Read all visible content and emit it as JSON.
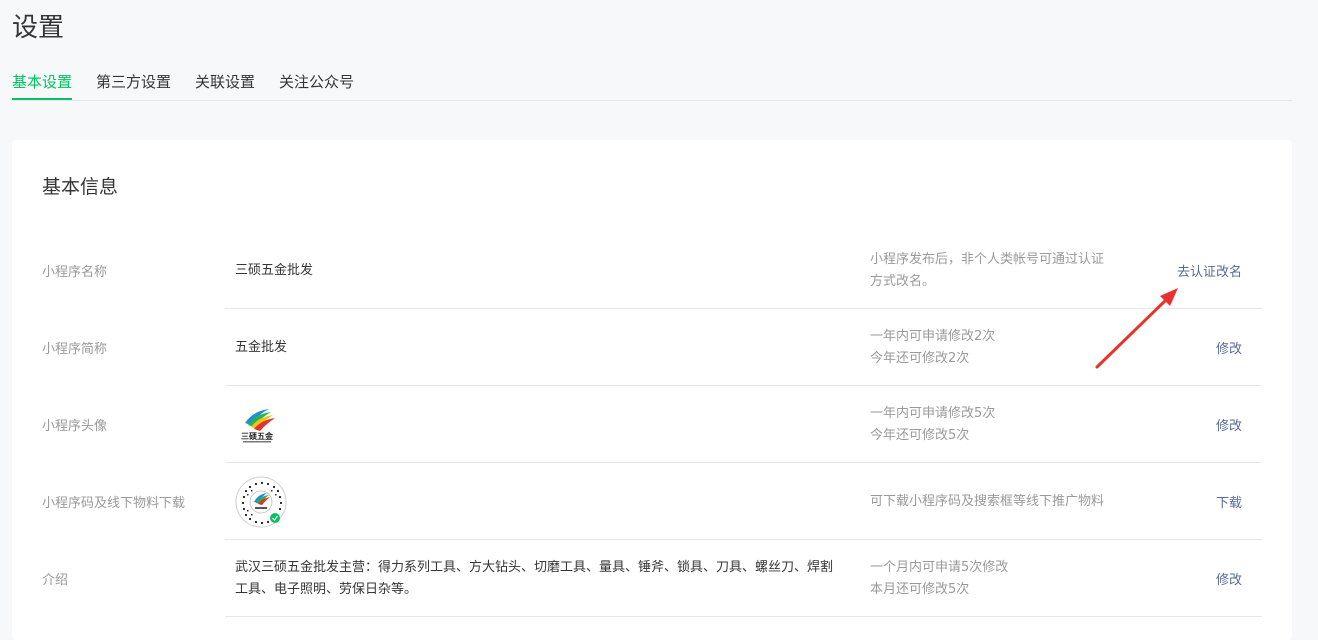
{
  "page": {
    "title": "设置"
  },
  "tabs": [
    {
      "label": "基本设置",
      "active": true
    },
    {
      "label": "第三方设置",
      "active": false
    },
    {
      "label": "关联设置",
      "active": false
    },
    {
      "label": "关注公众号",
      "active": false
    }
  ],
  "section": {
    "title": "基本信息"
  },
  "rows": [
    {
      "label": "小程序名称",
      "value": "三硕五金批发",
      "tip_line1": "小程序发布后，非个人类帐号可通过认证",
      "tip_line2": "方式改名。",
      "action": "去认证改名"
    },
    {
      "label": "小程序简称",
      "value": "五金批发",
      "tip_line1": "一年内可申请修改2次",
      "tip_line2": "今年还可修改2次",
      "action": "修改"
    },
    {
      "label": "小程序头像",
      "logo_text": "三硕五金",
      "tip_line1": "一年内可申请修改5次",
      "tip_line2": "今年还可修改5次",
      "action": "修改"
    },
    {
      "label": "小程序码及线下物料下载",
      "tip_line1": "可下载小程序码及搜索框等线下推广物料",
      "action": "下载"
    },
    {
      "label": "介绍",
      "value": "武汉三硕五金批发主营：得力系列工具、方大钻头、切磨工具、量具、锤斧、锁具、刀具、螺丝刀、焊割工具、电子照明、劳保日杂等。",
      "tip_line1": "一个月内可申请5次修改",
      "tip_line2": "本月还可修改5次",
      "action": "修改"
    }
  ],
  "colors": {
    "accent_green": "#07c160",
    "link_blue": "#576b95",
    "annotation_red": "#e8322e"
  }
}
